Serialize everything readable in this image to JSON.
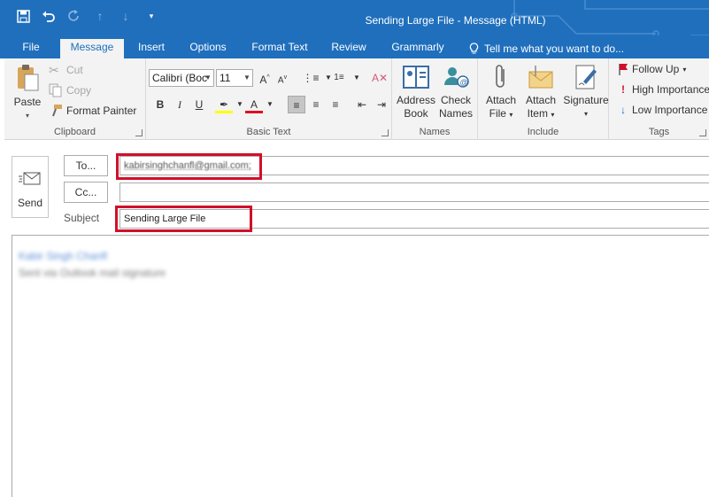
{
  "window": {
    "title": "Sending Large File - Message (HTML)"
  },
  "qat": {
    "save": "save-icon",
    "undo": "undo-icon",
    "redo": "redo-icon",
    "up": "up-arrow-icon",
    "down": "down-arrow-icon",
    "customize": "customize-qat-icon"
  },
  "tabs": [
    "File",
    "Message",
    "Insert",
    "Options",
    "Format Text",
    "Review",
    "Grammarly"
  ],
  "tellme": "Tell me what you want to do...",
  "ribbon": {
    "clipboard": {
      "label": "Clipboard",
      "paste": "Paste",
      "cut": "Cut",
      "copy": "Copy",
      "format_painter": "Format Painter"
    },
    "basic_text": {
      "label": "Basic Text",
      "font": "Calibri (Boc",
      "size": "11"
    },
    "names": {
      "label": "Names",
      "address_book_1": "Address",
      "address_book_2": "Book",
      "check_names_1": "Check",
      "check_names_2": "Names"
    },
    "include": {
      "label": "Include",
      "attach_file_1": "Attach",
      "attach_file_2": "File",
      "attach_item_1": "Attach",
      "attach_item_2": "Item",
      "signature": "Signature"
    },
    "tags": {
      "label": "Tags",
      "follow_up": "Follow Up",
      "high": "High Importance",
      "low": "Low Importance"
    }
  },
  "compose": {
    "send": "Send",
    "to_label": "To...",
    "cc_label": "Cc...",
    "subject_label": "Subject",
    "to_value": "kabirsinghchanfl@gmail.com;",
    "cc_value": "",
    "subject_value": "Sending Large File",
    "body_line1": "Kabir Singh Chanfl",
    "body_line2": "Sent via Outlook mail signature"
  },
  "colors": {
    "accent": "#1f6fbd",
    "highlight_box": "#d0102a"
  }
}
